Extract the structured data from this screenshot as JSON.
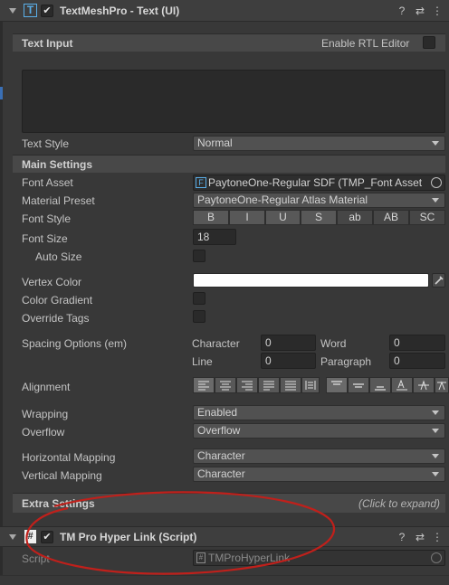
{
  "component1": {
    "title": "TextMeshPro - Text (UI)",
    "enabled_check": "✔",
    "icon_letter": "T"
  },
  "text_input": {
    "label": "Text Input",
    "rtl_label": "Enable RTL Editor"
  },
  "text_style": {
    "label": "Text Style",
    "value": "Normal"
  },
  "main_settings": {
    "label": "Main Settings",
    "font_asset_label": "Font Asset",
    "font_asset_value": "PaytoneOne-Regular SDF (TMP_Font Asset",
    "material_preset_label": "Material Preset",
    "material_preset_value": "PaytoneOne-Regular Atlas Material",
    "font_style_label": "Font Style",
    "font_style_buttons": [
      "B",
      "I",
      "U",
      "S",
      "ab",
      "AB",
      "SC"
    ],
    "font_size_label": "Font Size",
    "font_size_value": "18",
    "auto_size_label": "Auto Size",
    "vertex_color_label": "Vertex Color",
    "color_gradient_label": "Color Gradient",
    "override_tags_label": "Override Tags",
    "spacing_label": "Spacing Options (em)",
    "character_label": "Character",
    "character_value": "0",
    "word_label": "Word",
    "word_value": "0",
    "line_label": "Line",
    "line_value": "0",
    "paragraph_label": "Paragraph",
    "paragraph_value": "0",
    "alignment_label": "Alignment",
    "wrapping_label": "Wrapping",
    "wrapping_value": "Enabled",
    "overflow_label": "Overflow",
    "overflow_value": "Overflow",
    "horizontal_mapping_label": "Horizontal Mapping",
    "horizontal_mapping_value": "Character",
    "vertical_mapping_label": "Vertical Mapping",
    "vertical_mapping_value": "Character"
  },
  "extra_settings": {
    "label": "Extra Settings",
    "hint": "(Click to expand)"
  },
  "component2": {
    "title": "TM Pro Hyper Link (Script)",
    "script_label": "Script",
    "script_value": "TMProHyperLink",
    "enabled_check": "✔",
    "icon_letter": "#"
  },
  "header_icons": {
    "help": "?",
    "settings": "⇄",
    "menu": "⋮"
  },
  "colors": {
    "annotation_red": "#c0201b",
    "background": "#383838",
    "vertex_color": "#ffffff"
  }
}
